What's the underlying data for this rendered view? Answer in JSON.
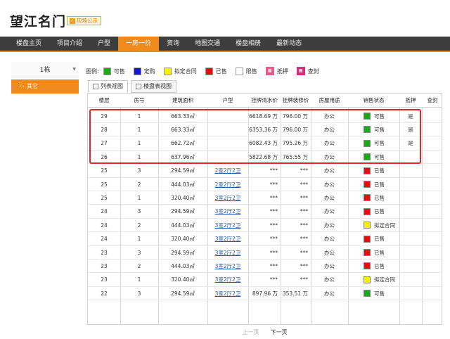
{
  "header": {
    "site_title": "望江名门",
    "badge": "现场公示"
  },
  "nav": {
    "items": [
      "楼盘主页",
      "项目介绍",
      "户型",
      "一房一价",
      "资询",
      "地图交通",
      "楼盘相册",
      "最新动态"
    ],
    "active_index": 3
  },
  "sidebar": {
    "building": "1栋",
    "sub_item": "其它"
  },
  "legend": {
    "title": "图例:",
    "items": [
      {
        "label": "可售",
        "color": "#1aa81a",
        "kind": "swatch"
      },
      {
        "label": "定购",
        "color": "#1616c8",
        "kind": "swatch"
      },
      {
        "label": "拟定合同",
        "color": "#f5f000",
        "kind": "swatch"
      },
      {
        "label": "已售",
        "color": "#e01010",
        "kind": "swatch"
      },
      {
        "label": "限售",
        "color": "#ffffff",
        "kind": "swatch"
      },
      {
        "label": "抵押",
        "color": "#e85a8a",
        "kind": "icon"
      },
      {
        "label": "查封",
        "color": "#d4307a",
        "kind": "icon"
      }
    ]
  },
  "view_tabs": [
    {
      "label": "列表视图",
      "active": true
    },
    {
      "label": "楼盘表视图",
      "active": false
    }
  ],
  "table": {
    "columns": [
      "楼层",
      "房号",
      "建筑面积",
      "户型",
      "挂牌清水价",
      "挂牌装修价",
      "房屋用途",
      "销售状态",
      "抵押",
      "查封"
    ],
    "rows": [
      {
        "floor": "29",
        "room": "1",
        "area": "663.33㎡",
        "layout": "",
        "price_plain": "6618.69 万",
        "price_deco": "796.00 万",
        "use": "办公",
        "status": "可售",
        "status_color": "#1aa81a",
        "mortgage": "是",
        "seal": ""
      },
      {
        "floor": "28",
        "room": "1",
        "area": "663.33㎡",
        "layout": "",
        "price_plain": "6353.36 万",
        "price_deco": "796.00 万",
        "use": "办公",
        "status": "可售",
        "status_color": "#1aa81a",
        "mortgage": "是",
        "seal": ""
      },
      {
        "floor": "27",
        "room": "1",
        "area": "662.72㎡",
        "layout": "",
        "price_plain": "6082.43 万",
        "price_deco": "795.26 万",
        "use": "办公",
        "status": "可售",
        "status_color": "#1aa81a",
        "mortgage": "是",
        "seal": ""
      },
      {
        "floor": "26",
        "room": "1",
        "area": "637.96㎡",
        "layout": "",
        "price_plain": "5822.68 万",
        "price_deco": "765.55 万",
        "use": "办公",
        "status": "可售",
        "status_color": "#1aa81a",
        "mortgage": "",
        "seal": ""
      },
      {
        "floor": "25",
        "room": "3",
        "area": "294.59㎡",
        "layout": "2室2厅2卫",
        "price_plain": "***",
        "price_deco": "***",
        "use": "办公",
        "status": "已售",
        "status_color": "#e01010",
        "mortgage": "",
        "seal": ""
      },
      {
        "floor": "25",
        "room": "2",
        "area": "444.03㎡",
        "layout": "2室2厅2卫",
        "price_plain": "***",
        "price_deco": "***",
        "use": "办公",
        "status": "已售",
        "status_color": "#e01010",
        "mortgage": "",
        "seal": ""
      },
      {
        "floor": "25",
        "room": "1",
        "area": "320.40㎡",
        "layout": "3室2厅2卫",
        "price_plain": "***",
        "price_deco": "***",
        "use": "办公",
        "status": "已售",
        "status_color": "#e01010",
        "mortgage": "",
        "seal": ""
      },
      {
        "floor": "24",
        "room": "3",
        "area": "294.59㎡",
        "layout": "3室2厅2卫",
        "price_plain": "***",
        "price_deco": "***",
        "use": "办公",
        "status": "已售",
        "status_color": "#e01010",
        "mortgage": "",
        "seal": ""
      },
      {
        "floor": "24",
        "room": "2",
        "area": "444.03㎡",
        "layout": "3室2厅2卫",
        "price_plain": "***",
        "price_deco": "***",
        "use": "办公",
        "status": "拟定合同",
        "status_color": "#f5f000",
        "mortgage": "",
        "seal": ""
      },
      {
        "floor": "24",
        "room": "1",
        "area": "320.40㎡",
        "layout": "3室2厅2卫",
        "price_plain": "***",
        "price_deco": "***",
        "use": "办公",
        "status": "已售",
        "status_color": "#e01010",
        "mortgage": "",
        "seal": ""
      },
      {
        "floor": "23",
        "room": "3",
        "area": "294.59㎡",
        "layout": "3室2厅2卫",
        "price_plain": "***",
        "price_deco": "***",
        "use": "办公",
        "status": "已售",
        "status_color": "#e01010",
        "mortgage": "",
        "seal": ""
      },
      {
        "floor": "23",
        "room": "2",
        "area": "444.03㎡",
        "layout": "3室2厅2卫",
        "price_plain": "***",
        "price_deco": "***",
        "use": "办公",
        "status": "已售",
        "status_color": "#e01010",
        "mortgage": "",
        "seal": ""
      },
      {
        "floor": "23",
        "room": "1",
        "area": "320.40㎡",
        "layout": "3室2厅2卫",
        "price_plain": "***",
        "price_deco": "***",
        "use": "办公",
        "status": "拟定合同",
        "status_color": "#f5f000",
        "mortgage": "",
        "seal": ""
      },
      {
        "floor": "22",
        "room": "3",
        "area": "294.59㎡",
        "layout": "3室2厅2卫",
        "price_plain": "897.96 万",
        "price_deco": "353.51 万",
        "use": "办公",
        "status": "可售",
        "status_color": "#1aa81a",
        "mortgage": "",
        "seal": ""
      }
    ]
  },
  "pager": {
    "prev": "上一页",
    "next": "下一页"
  },
  "colors": {
    "accent": "#f08a1c",
    "nav_bg": "#3d3d3d",
    "highlight": "#e0272a"
  }
}
